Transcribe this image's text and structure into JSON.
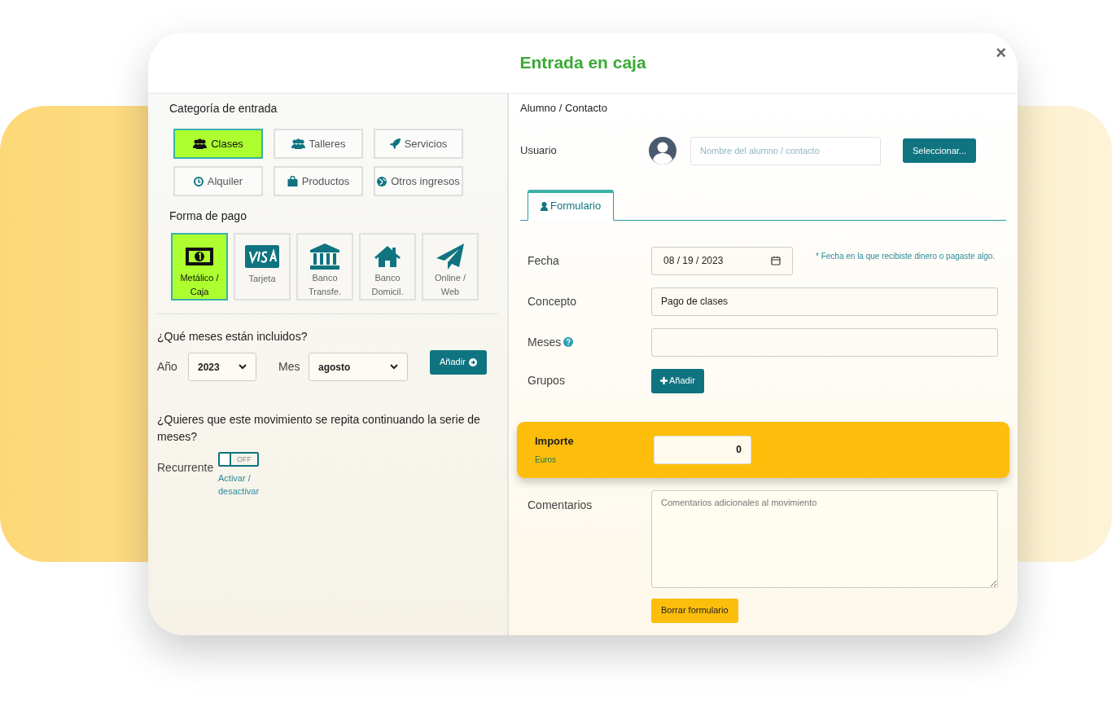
{
  "window": {
    "title": "Entrada en caja",
    "close": "×"
  },
  "category": {
    "title": "Categoría de entrada",
    "items": [
      {
        "label": "Clases",
        "selected": true
      },
      {
        "label": "Talleres",
        "selected": false
      },
      {
        "label": "Servicios",
        "selected": false
      },
      {
        "label": "Alquiler",
        "selected": false
      },
      {
        "label": "Productos",
        "selected": false
      },
      {
        "label": "Otros ingresos",
        "selected": false
      }
    ]
  },
  "payment": {
    "title": "Forma de pago",
    "items": [
      {
        "label": "Metálico / Caja",
        "selected": true
      },
      {
        "label": "Tarjeta",
        "selected": false
      },
      {
        "label": "Banco Transfe.",
        "selected": false
      },
      {
        "label": "Banco Domicil.",
        "selected": false
      },
      {
        "label": "Online / Web",
        "selected": false
      }
    ]
  },
  "months": {
    "question": "¿Qué meses están incluidos?",
    "year_label": "Año",
    "year_value": "2023",
    "month_label": "Mes",
    "month_value": "agosto",
    "add_button": "Añadir"
  },
  "recurrence": {
    "question": "¿Quieres que este movimiento se repita continuando la serie de meses?",
    "label": "Recurrente",
    "toggle": {
      "on": false,
      "text": "OFF"
    },
    "hint": "Activar / desactivar"
  },
  "contact": {
    "title": "Alumno / Contacto",
    "user_label": "Usuario",
    "name_placeholder": "Nombre del alumno / contacto",
    "select_button": "Seleccionar..."
  },
  "tabs": [
    {
      "label": "Formulario",
      "selected": true
    }
  ],
  "form": {
    "date_label": "Fecha",
    "date_value": "08 / 19 / 2023",
    "date_hint": "* Fecha en la que recibiste dinero o pagaste algo.",
    "concept_label": "Concepto",
    "concept_value": "Pago de clases",
    "months_label": "Meses",
    "groups_label": "Grupos",
    "groups_button": "Añadir"
  },
  "amount": {
    "title": "Importe",
    "currency": "Euros",
    "value": "0"
  },
  "comments": {
    "label": "Comentarios",
    "placeholder": "Comentarios adicionales al movimiento"
  },
  "reset_button": "Borrar formulario"
}
